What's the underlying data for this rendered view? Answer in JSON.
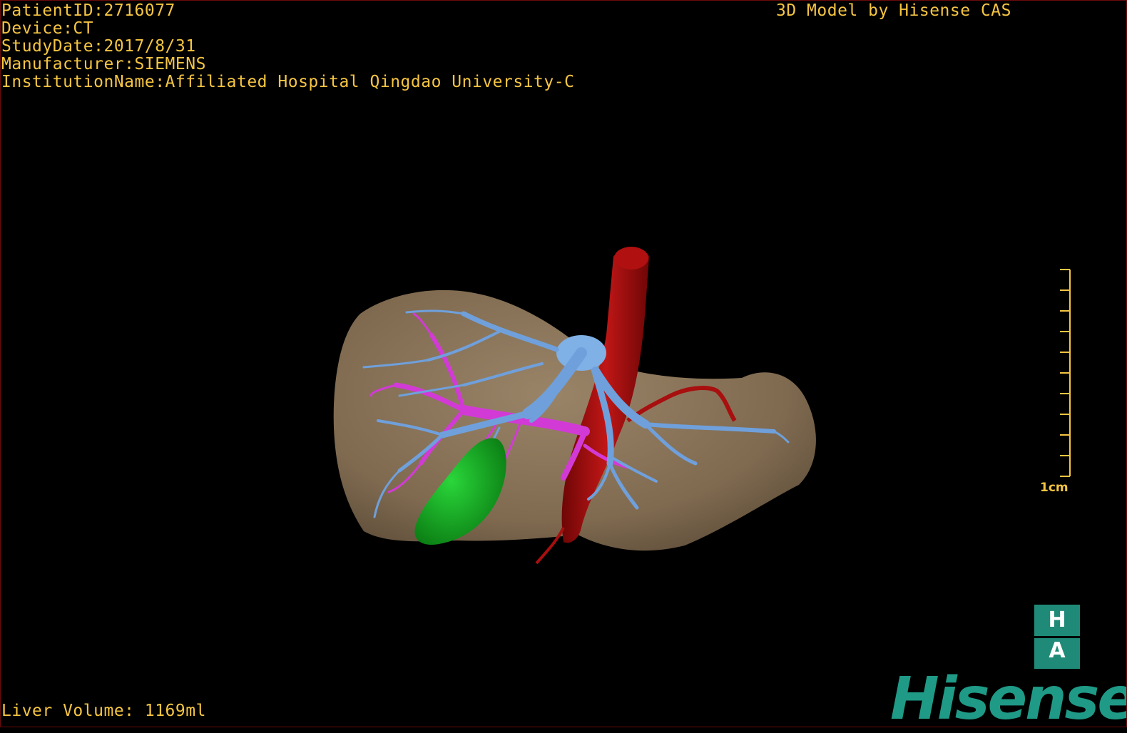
{
  "info": {
    "patient_id": "PatientID:2716077",
    "device": "Device:CT",
    "study_date": "StudyDate:2017/8/31",
    "manufacturer": "Manufacturer:SIEMENS",
    "institution": "InstitutionName:Affiliated Hospital Qingdao University-C"
  },
  "credit": "3D Model by Hisense CAS",
  "liver_volume": "Liver Volume: 1169ml",
  "scale_bar": {
    "label": "1cm",
    "ticks": 10
  },
  "logo": {
    "badge_top": "H",
    "badge_bottom": "A",
    "brand": "Hisense"
  },
  "colors": {
    "overlay_text": "#f5c542",
    "liver": "#8a7458",
    "portal_vein": "#6fa0dc",
    "hepatic_vein": "#d23ad6",
    "artery": "#a80f0f",
    "gallbladder": "#12a81e",
    "brand": "#1f9a87"
  },
  "structures": [
    "liver",
    "hepatic-vein",
    "portal-vein",
    "aorta",
    "hepatic-artery",
    "gallbladder"
  ]
}
